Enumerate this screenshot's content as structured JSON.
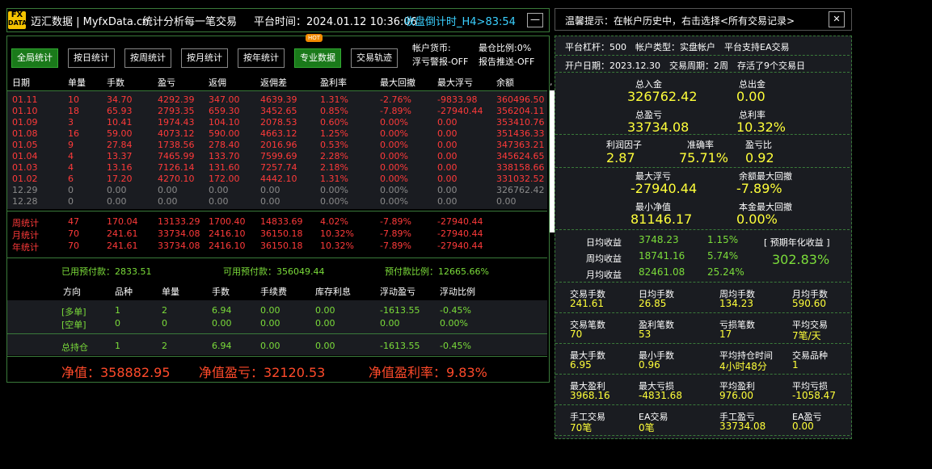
{
  "title": {
    "logo_top": "FX",
    "logo_bottom": "DATA",
    "name": "迈汇数据 | MyfxData.cn",
    "slogan": "统计分析每一笔交易",
    "platform_time": "平台时间：2024.01.12 10:36:06",
    "countdown": "收盘倒计时_H4>83:54",
    "minimize": "—"
  },
  "toolbar": {
    "buttons": [
      "全局统计",
      "按日统计",
      "按周统计",
      "按月统计",
      "按年统计",
      "专业数据",
      "交易轨迹"
    ],
    "hot_badge": "HOT",
    "account_currency": "帐户货币:",
    "max_position": "最仓比例:0%",
    "float_warning": "浮亏警报-OFF",
    "report_push": "报告推送-OFF"
  },
  "table": {
    "headers": [
      "日期",
      "单量",
      "手数",
      "盈亏",
      "返佣",
      "返佣差",
      "盈利率",
      "最大回撤",
      "最大浮亏",
      "余额"
    ],
    "rows": [
      [
        "01.11",
        "10",
        "34.70",
        "4292.39",
        "347.00",
        "4639.39",
        "1.31%",
        "-2.76%",
        "-9833.98",
        "360496.50"
      ],
      [
        "01.10",
        "18",
        "65.93",
        "2793.35",
        "659.30",
        "3452.65",
        "0.85%",
        "-7.89%",
        "-27940.44",
        "356204.11"
      ],
      [
        "01.09",
        "3",
        "10.41",
        "1974.43",
        "104.10",
        "2078.53",
        "0.60%",
        "0.00%",
        "0.00",
        "353410.76"
      ],
      [
        "01.08",
        "16",
        "59.00",
        "4073.12",
        "590.00",
        "4663.12",
        "1.25%",
        "0.00%",
        "0.00",
        "351436.33"
      ],
      [
        "01.05",
        "9",
        "27.84",
        "1738.56",
        "278.40",
        "2016.96",
        "0.53%",
        "0.00%",
        "0.00",
        "347363.21"
      ],
      [
        "01.04",
        "4",
        "13.37",
        "7465.99",
        "133.70",
        "7599.69",
        "2.28%",
        "0.00%",
        "0.00",
        "345624.65"
      ],
      [
        "01.03",
        "4",
        "13.16",
        "7126.14",
        "131.60",
        "7257.74",
        "2.18%",
        "0.00%",
        "0.00",
        "338158.66"
      ],
      [
        "01.02",
        "6",
        "17.20",
        "4270.10",
        "172.00",
        "4442.10",
        "1.31%",
        "0.00%",
        "0.00",
        "331032.52"
      ],
      [
        "12.29",
        "0",
        "0.00",
        "0.00",
        "0.00",
        "0.00",
        "0.00%",
        "0.00%",
        "0.00",
        "326762.42"
      ],
      [
        "12.28",
        "0",
        "0.00",
        "0.00",
        "0.00",
        "0.00",
        "0.00%",
        "0.00%",
        "0.00",
        "0.00"
      ]
    ],
    "summary": [
      [
        "周统计",
        "47",
        "170.04",
        "13133.29",
        "1700.40",
        "14833.69",
        "4.02%",
        "-7.89%",
        "-27940.44"
      ],
      [
        "月统计",
        "70",
        "241.61",
        "33734.08",
        "2416.10",
        "36150.18",
        "10.32%",
        "-7.89%",
        "-27940.44"
      ],
      [
        "年统计",
        "70",
        "241.61",
        "33734.08",
        "2416.10",
        "36150.18",
        "10.32%",
        "-7.89%",
        "-27940.44"
      ]
    ]
  },
  "margin": {
    "used": "已用预付款：2833.51",
    "free": "可用预付款：356049.44",
    "ratio": "预付款比例：12665.66%"
  },
  "positions": {
    "headers": [
      "方向",
      "品种",
      "单量",
      "手数",
      "手续费",
      "库存利息",
      "浮动盈亏",
      "浮动比例"
    ],
    "rows": [
      [
        "[多单]",
        "1",
        "2",
        "6.94",
        "0.00",
        "0.00",
        "-1613.55",
        "-0.45%"
      ],
      [
        "[空单]",
        "0",
        "0",
        "0.00",
        "0.00",
        "0.00",
        "0.00",
        "0.00%"
      ]
    ],
    "total": [
      "总持仓",
      "1",
      "2",
      "6.94",
      "0.00",
      "0.00",
      "-1613.55",
      "-0.45%"
    ]
  },
  "footer": {
    "equity": "净值：358882.95",
    "equity_pnl": "净值盈亏：32120.53",
    "equity_rate": "净值盈利率：9.83%"
  },
  "right": {
    "tip": "温馨提示：在帐户历史中，右击选择<所有交易记录>",
    "close": "✕",
    "info1": "平台杠杆：500　帐户类型：实盘帐户　平台支持EA交易",
    "info2": "开户日期：2023.12.30　交易周期：2周　存活了9个交易日",
    "deposit_label": "总入金",
    "deposit": "326762.42",
    "withdraw_label": "总出金",
    "withdraw": "0.00",
    "pnl_label": "总盈亏",
    "pnl": "33734.08",
    "rate_label": "总利率",
    "rate": "10.32%",
    "pf_label": "利润因子",
    "pf": "2.87",
    "acc_label": "准确率",
    "acc": "75.71%",
    "ratio_label": "盈亏比",
    "ratio": "0.92",
    "maxfloat_label": "最大浮亏",
    "maxfloat": "-27940.44",
    "maxdd_label": "余额最大回撤",
    "maxdd": "-7.89%",
    "minnet_label": "最小净值",
    "minnet": "81146.17",
    "capdd_label": "本金最大回撤",
    "capdd": "0.00%",
    "daily_label": "日均收益",
    "daily": "3748.23",
    "daily_pct": "1.15%",
    "weekly_label": "周均收益",
    "weekly": "18741.16",
    "weekly_pct": "5.74%",
    "monthly_label": "月均收益",
    "monthly": "82461.08",
    "monthly_pct": "25.24%",
    "annual_label": "[ 预期年化收益 ]",
    "annual": "302.83%",
    "grid": [
      [
        [
          "交易手数",
          "241.61"
        ],
        [
          "日均手数",
          "26.85"
        ],
        [
          "周均手数",
          "134.23"
        ],
        [
          "月均手数",
          "590.60"
        ]
      ],
      [
        [
          "交易笔数",
          "70"
        ],
        [
          "盈利笔数",
          "53"
        ],
        [
          "亏损笔数",
          "17"
        ],
        [
          "平均交易",
          "7笔/天"
        ]
      ],
      [
        [
          "最大手数",
          "6.95"
        ],
        [
          "最小手数",
          "0.96"
        ],
        [
          "平均持仓时间",
          "4小时48分"
        ],
        [
          "交易品种",
          "1"
        ]
      ],
      [
        [
          "最大盈利",
          "3968.16"
        ],
        [
          "最大亏损",
          "-4831.68"
        ],
        [
          "平均盈利",
          "976.00"
        ],
        [
          "平均亏损",
          "-1058.47"
        ]
      ],
      [
        [
          "手工交易",
          "70笔"
        ],
        [
          "EA交易",
          "0笔"
        ],
        [
          "手工盈亏",
          "33734.08"
        ],
        [
          "EA盈亏",
          "0.00"
        ]
      ]
    ]
  }
}
